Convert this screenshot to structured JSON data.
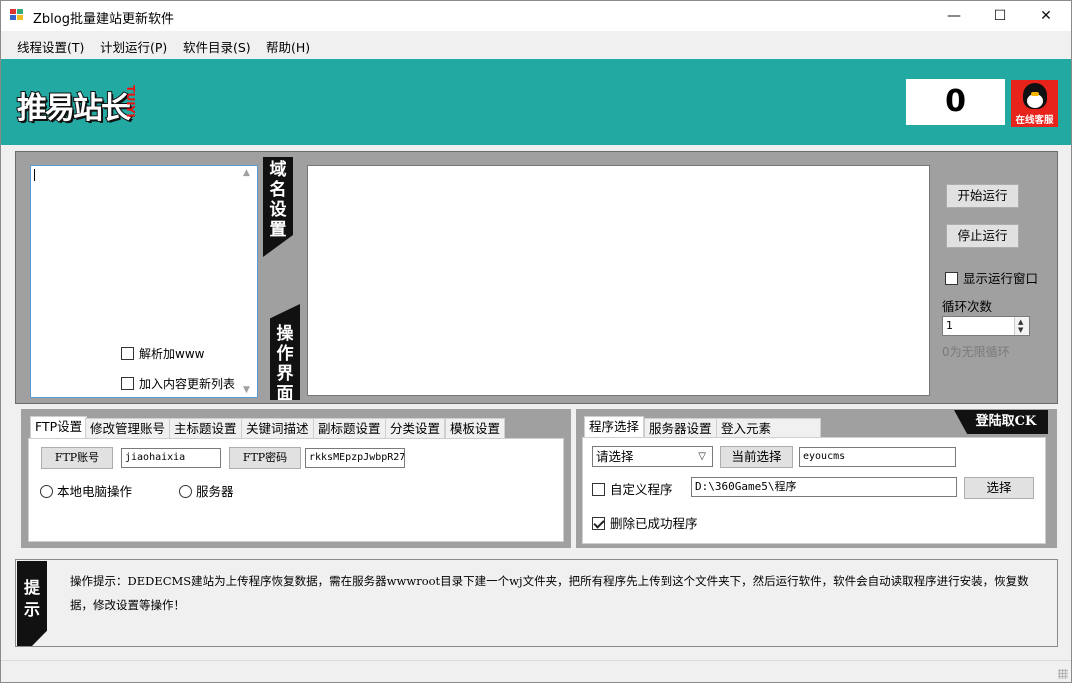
{
  "window": {
    "title": "Zblog批量建站更新软件",
    "minimize_glyph": "—",
    "maximize_glyph": "☐",
    "close_glyph": "✕"
  },
  "menu": {
    "items": [
      {
        "label": "线程设置(T)"
      },
      {
        "label": "计划运行(P)"
      },
      {
        "label": "软件目录(S)"
      },
      {
        "label": "帮助(H)"
      }
    ]
  },
  "banner": {
    "logo_text": "推易站长",
    "logo_sub": "TUIYI",
    "counter": "0",
    "support_label": "在线客服",
    "background": "#21a9a2"
  },
  "domain_panel": {
    "vtab_label": "域名设置",
    "parse_www_label": "解析加www",
    "add_content_label": "加入内容更新列表",
    "parse_www_checked": false,
    "add_content_checked": false
  },
  "operation_panel": {
    "vtab_label": "操作界面"
  },
  "controls": {
    "start_label": "开始运行",
    "stop_label": "停止运行",
    "show_window_label": "显示运行窗口",
    "show_window_checked": false,
    "loop_label": "循环次数",
    "loop_value": "1",
    "loop_hint": "0为无限循环"
  },
  "ftp_tabs": {
    "tabs": [
      {
        "label": "FTP设置"
      },
      {
        "label": "修改管理账号"
      },
      {
        "label": "主标题设置"
      },
      {
        "label": "关键词描述"
      },
      {
        "label": "副标题设置"
      },
      {
        "label": "分类设置"
      },
      {
        "label": "模板设置"
      }
    ],
    "active_index": 0,
    "ftp_account_label": "FTP账号",
    "ftp_account_value": "jiaohaixia",
    "ftp_password_label": "FTP密码",
    "ftp_password_value": "rkksMEpzpJwbpR27",
    "local_label": "本地电脑操作",
    "server_label": "服务器"
  },
  "program_tabs": {
    "tabs": [
      {
        "label": "程序选择"
      },
      {
        "label": "服务器设置"
      },
      {
        "label": "登入元素"
      }
    ],
    "active_index": 0,
    "login_tag": "登陆取CK",
    "select_value": "请选择",
    "current_select_label": "当前选择",
    "current_value": "eyoucms",
    "custom_program_label": "自定义程序",
    "custom_program_checked": false,
    "path_value": "D:\\360Game5\\程序",
    "choose_label": "选择",
    "delete_success_label": "删除已成功程序",
    "delete_success_checked": true
  },
  "tip": {
    "tag": "提示",
    "text": "操作提示：DEDECMS建站为上传程序恢复数据，需在服务器wwwroot目录下建一个wj文件夹，把所有程序先上传到这个文件夹下，然后运行软件，软件会自动读取程序进行安装，恢复数据，修改设置等操作！"
  }
}
